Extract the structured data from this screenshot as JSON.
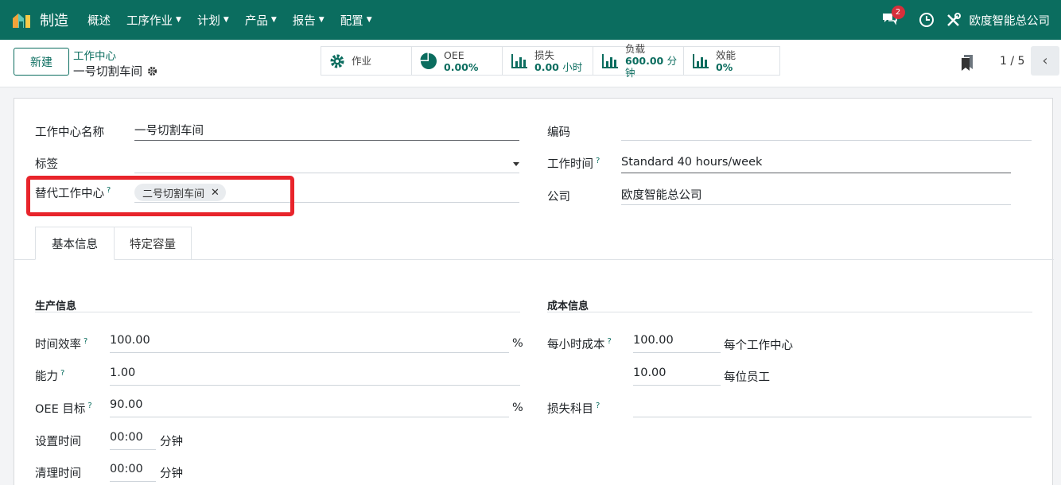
{
  "navbar": {
    "app_name": "制造",
    "menu": [
      {
        "label": "概述",
        "has_caret": false
      },
      {
        "label": "工序作业",
        "has_caret": true
      },
      {
        "label": "计划",
        "has_caret": true
      },
      {
        "label": "产品",
        "has_caret": true
      },
      {
        "label": "报告",
        "has_caret": true
      },
      {
        "label": "配置",
        "has_caret": true
      }
    ],
    "message_count": "2",
    "company": "欧度智能总公司",
    "color": "#0b6d5f"
  },
  "control": {
    "new_label": "新建",
    "breadcrumb": "工作中心",
    "record_name": "一号切割车间",
    "stats": [
      {
        "icon": "gear-icon",
        "label": "作业",
        "value": "",
        "unit": ""
      },
      {
        "icon": "pie-chart-icon",
        "label": "OEE",
        "value": "0.00%",
        "unit": ""
      },
      {
        "icon": "bar-chart-icon",
        "label": "损失",
        "value": "0.00",
        "unit": "小时"
      },
      {
        "icon": "bar-chart-icon",
        "label": "负载",
        "value": "600.00",
        "unit": "分钟"
      },
      {
        "icon": "bar-chart-icon",
        "label": "效能",
        "value": "0%",
        "unit": ""
      }
    ],
    "pager": "1 / 5"
  },
  "form": {
    "name_label": "工作中心名称",
    "name_value": "一号切割车间",
    "tag_label": "标签",
    "alt_label": "替代工作中心",
    "alt_tag": "二号切割车间",
    "code_label": "编码",
    "code_value": "",
    "worktime_label": "工作时间",
    "worktime_value": "Standard 40 hours/week",
    "company_label": "公司",
    "company_value": "欧度智能总公司"
  },
  "tabs": [
    "基本信息",
    "特定容量"
  ],
  "production": {
    "title": "生产信息",
    "efficiency_label": "时间效率",
    "efficiency_value": "100.00",
    "capacity_label": "能力",
    "capacity_value": "1.00",
    "oee_label": "OEE 目标",
    "oee_value": "90.00",
    "setup_label": "设置时间",
    "setup_value": "00:00",
    "cleanup_label": "清理时间",
    "cleanup_value": "00:00",
    "percent": "%",
    "minutes": "分钟"
  },
  "cost": {
    "title": "成本信息",
    "hourly_label": "每小时成本",
    "hourly_value": "100.00",
    "hourly_unit": "每个工作中心",
    "employee_value": "10.00",
    "employee_unit": "每位员工",
    "loss_label": "损失科目",
    "loss_value": ""
  }
}
